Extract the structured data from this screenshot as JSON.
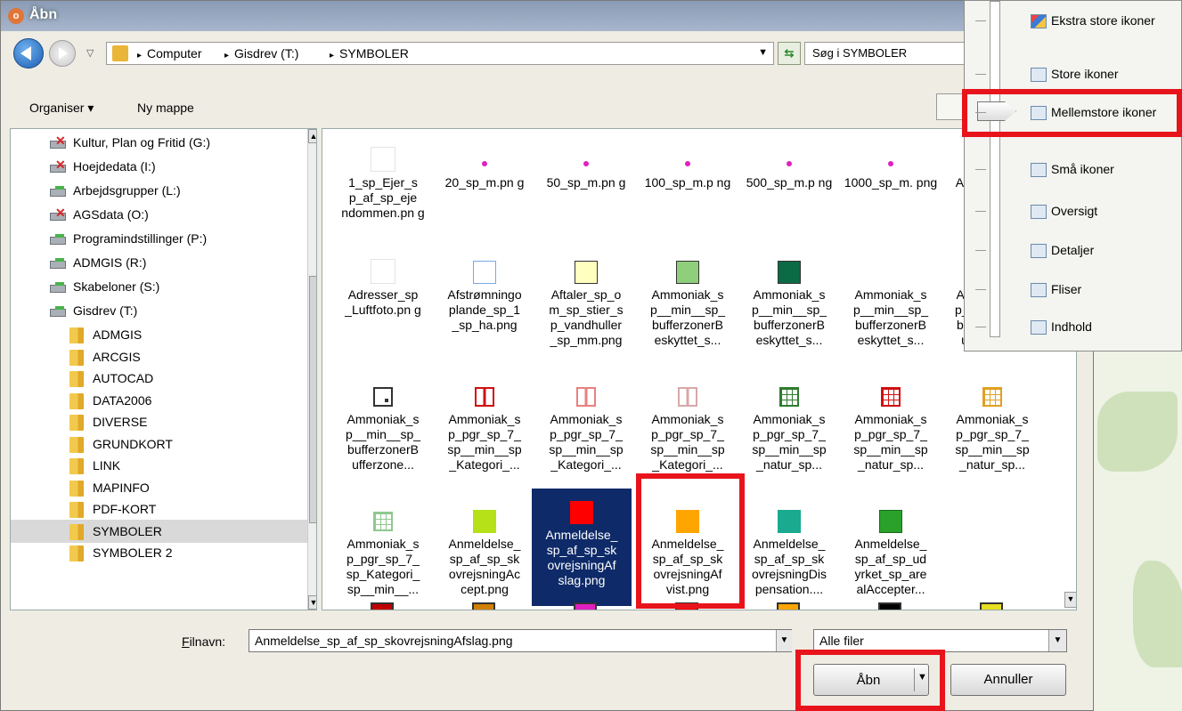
{
  "window": {
    "title": "Åbn"
  },
  "address": {
    "crumbs": [
      "Computer",
      "Gisdrev (T:)",
      "SYMBOLER"
    ],
    "search_placeholder": "Søg i SYMBOLER"
  },
  "toolbar": {
    "organize": "Organiser",
    "new_folder": "Ny mappe"
  },
  "nav": {
    "drives": [
      {
        "label": "Kultur, Plan og Fritid (G:)",
        "status": "disconnected"
      },
      {
        "label": "Hoejdedata (I:)",
        "status": "disconnected"
      },
      {
        "label": "Arbejdsgrupper (L:)",
        "status": "connected"
      },
      {
        "label": "AGSdata (O:)",
        "status": "disconnected"
      },
      {
        "label": "Programindstillinger (P:)",
        "status": "connected"
      },
      {
        "label": "ADMGIS (R:)",
        "status": "connected"
      },
      {
        "label": "Skabeloner (S:)",
        "status": "connected"
      },
      {
        "label": "Gisdrev (T:)",
        "status": "connected"
      }
    ],
    "folders": [
      "ADMGIS",
      "ARCGIS",
      "AUTOCAD",
      "DATA2006",
      "DIVERSE",
      "GRUNDKORT",
      "LINK",
      "MAPINFO",
      "PDF-KORT",
      "SYMBOLER",
      "SYMBOLER 2"
    ],
    "selected_folder": "SYMBOLER"
  },
  "files": [
    {
      "name": "1_sp_Ejer_s p_af_sp_eje ndommen.pn g",
      "icon": "blank"
    },
    {
      "name": "20_sp_m.pn g",
      "icon": "dot",
      "color": "#e020c0"
    },
    {
      "name": "50_sp_m.pn g",
      "icon": "dot",
      "color": "#e020c0"
    },
    {
      "name": "100_sp_m.p ng",
      "icon": "dot",
      "color": "#e020c0"
    },
    {
      "name": "500_sp_m.p ng",
      "icon": "dot",
      "color": "#e020c0"
    },
    {
      "name": "1000_sp_m. png",
      "icon": "dot",
      "color": "#e020c0"
    },
    {
      "name": "Adresser_hig hlight.png",
      "icon": "ring",
      "color": "#1ed9e8"
    },
    {
      "name": "Adresser_sp _Luftfoto.pn g",
      "icon": "blank"
    },
    {
      "name": "Afstrømningo plande_sp_1 _sp_ha.png",
      "icon": "square",
      "color": "#ffffff",
      "border": "#7aa8e0"
    },
    {
      "name": "Aftaler_sp_o m_sp_stier_s p_vandhuller _sp_mm.png",
      "icon": "square",
      "color": "#ffffc0",
      "border": "#333333"
    },
    {
      "name": "Ammoniak_s p__min__sp_ bufferzonerB eskyttet_s...",
      "icon": "square",
      "color": "#8fce7a",
      "border": "#333333"
    },
    {
      "name": "Ammoniak_s p__min__sp_ bufferzonerB eskyttet_s...",
      "icon": "square",
      "color": "#0b6b45",
      "border": "#333333"
    },
    {
      "name": "Ammoniak_s p__min__sp_ bufferzonerB eskyttet_s...",
      "icon": "hidden"
    },
    {
      "name": "Ammoniak_s p__min__sp_ bufferzonerB ufferzone...",
      "icon": "dotgrid",
      "color": "#333333"
    },
    {
      "name": "Ammoniak_s p__min__sp_ bufferzonerB ufferzone...",
      "icon": "cornerdot",
      "color": "#333333"
    },
    {
      "name": "Ammoniak_s p_pgr_sp_7_ sp__min__sp _Kategori_...",
      "icon": "bars",
      "color": "#d01010"
    },
    {
      "name": "Ammoniak_s p_pgr_sp_7_ sp__min__sp _Kategori_...",
      "icon": "bars",
      "color": "#e88080"
    },
    {
      "name": "Ammoniak_s p_pgr_sp_7_ sp__min__sp _Kategori_...",
      "icon": "bars",
      "color": "#d8a8a8"
    },
    {
      "name": "Ammoniak_s p_pgr_sp_7_ sp__min__sp _natur_sp...",
      "icon": "grid",
      "color": "#2f7a2f"
    },
    {
      "name": "Ammoniak_s p_pgr_sp_7_ sp__min__sp _natur_sp...",
      "icon": "grid",
      "color": "#d01010"
    },
    {
      "name": "Ammoniak_s p_pgr_sp_7_ sp__min__sp _natur_sp...",
      "icon": "grid",
      "color": "#e0a020"
    },
    {
      "name": "Ammoniak_s p_pgr_sp_7_ sp_Kategori_ sp__min__...",
      "icon": "grid",
      "color": "#90c890"
    },
    {
      "name": "Anmeldelse_ sp_af_sp_sk ovrejsningAc cept.png",
      "icon": "square",
      "color": "#b6e018",
      "border": "#b6e018"
    },
    {
      "name": "Anmeldelse_ sp_af_sp_sk ovrejsningAf slag.png",
      "icon": "square",
      "color": "#ff0000",
      "border": "#ff0000",
      "selected": true
    },
    {
      "name": "Anmeldelse_ sp_af_sp_sk ovrejsningAf vist.png",
      "icon": "square",
      "color": "#ffa500",
      "border": "#ffa500"
    },
    {
      "name": "Anmeldelse_ sp_af_sp_sk ovrejsningDis pensation....",
      "icon": "square",
      "color": "#1aaa90",
      "border": "#1aaa90"
    },
    {
      "name": "Anmeldelse_ sp_af_sp_ud yrket_sp_are alAccepter...",
      "icon": "square",
      "color": "#2aa12a",
      "border": "#1a6a1a"
    }
  ],
  "partial_row_colors": [
    "#c00000",
    "#d08000",
    "#e020c0",
    "#ff0000",
    "#ffa500",
    "#000000",
    "#e8e020"
  ],
  "bottom": {
    "filename_label": "Filnavn:",
    "filename_value": "Anmeldelse_sp_af_sp_skovrejsningAfslag.png",
    "filetype_value": "Alle filer",
    "open_label": "Åbn",
    "cancel_label": "Annuller"
  },
  "view_menu": {
    "items": [
      "Ekstra store ikoner",
      "Store ikoner",
      "Mellemstore ikoner",
      "Små ikoner",
      "Oversigt",
      "Detaljer",
      "Fliser",
      "Indhold"
    ],
    "selected": "Mellemstore ikoner"
  },
  "highlight_color": "#e8141c"
}
